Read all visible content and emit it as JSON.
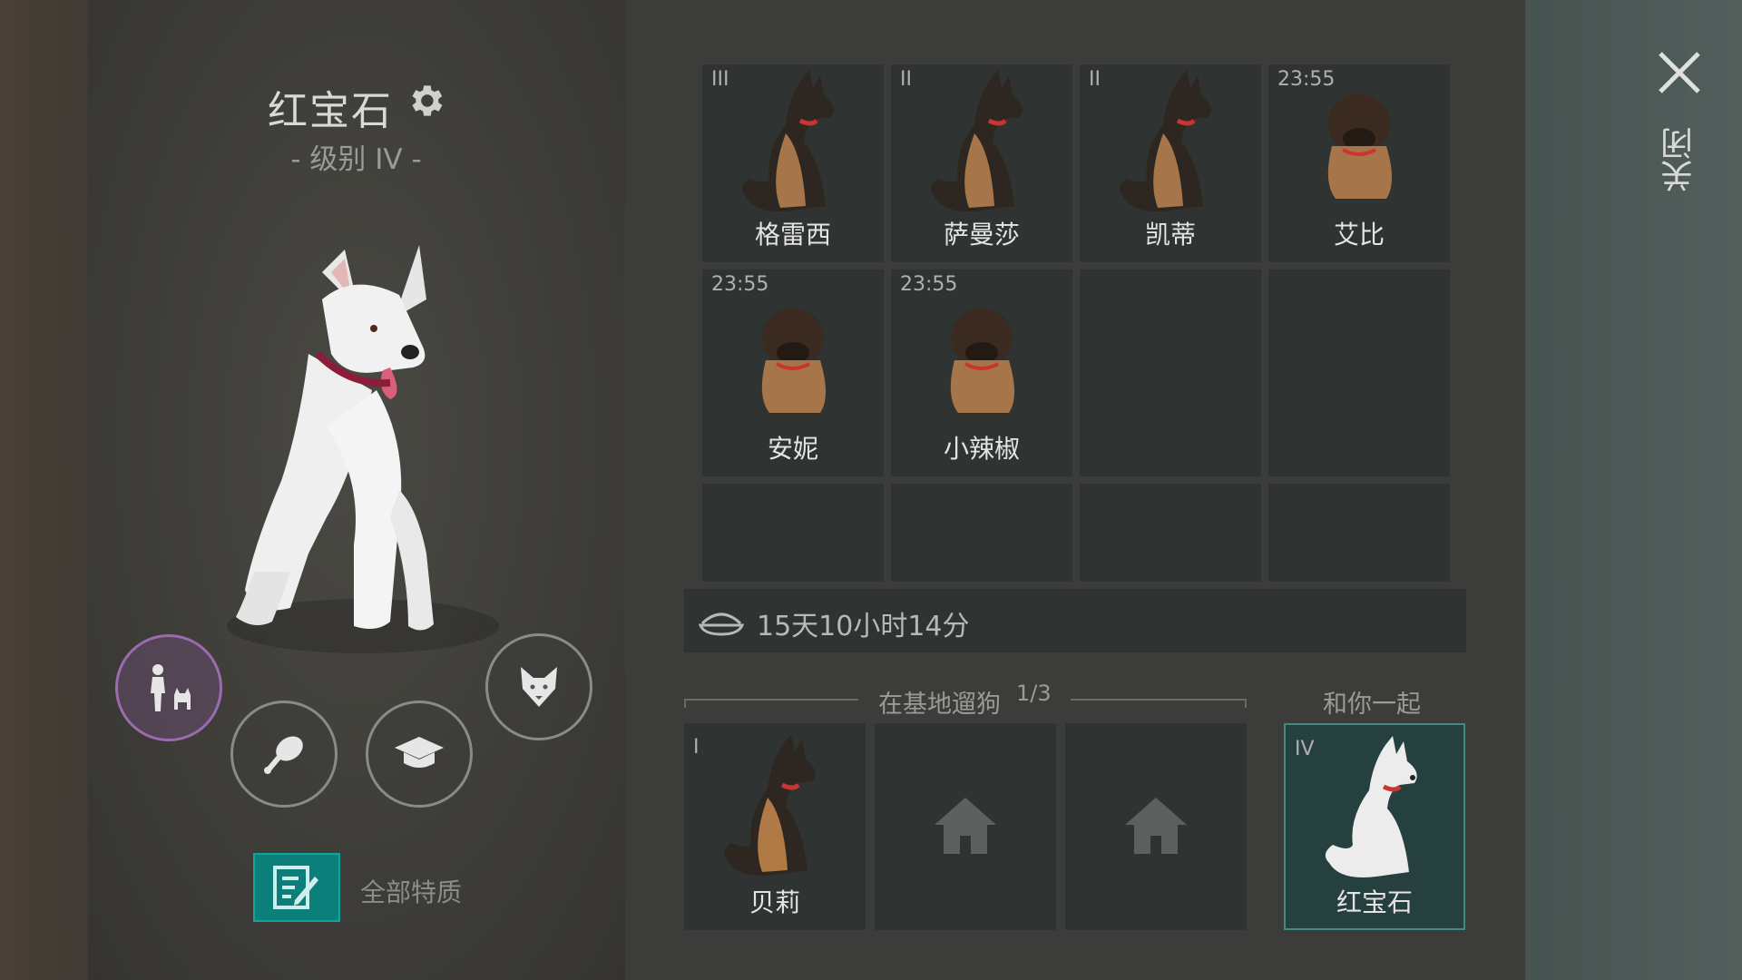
{
  "pet": {
    "name": "红宝石",
    "level": "- 级别 IV -"
  },
  "actions": {
    "traits_label": "全部特质"
  },
  "kennel": {
    "cells": [
      {
        "tag": "III",
        "name": "格雷西",
        "type": "adult-shepherd"
      },
      {
        "tag": "II",
        "name": "萨曼莎",
        "type": "adult-shepherd"
      },
      {
        "tag": "II",
        "name": "凯蒂",
        "type": "adult-shepherd"
      },
      {
        "tag": "23:55",
        "name": "艾比",
        "type": "puppy"
      },
      {
        "tag": "23:55",
        "name": "安妮",
        "type": "puppy"
      },
      {
        "tag": "23:55",
        "name": "小辣椒",
        "type": "puppy"
      }
    ]
  },
  "food": {
    "time_left": "15天10小时14分"
  },
  "walking": {
    "label": "在基地遛狗",
    "count": "1/3",
    "dogs": [
      {
        "tag": "I",
        "name": "贝莉"
      }
    ]
  },
  "with_you": {
    "label": "和你一起",
    "tag": "IV",
    "name": "红宝石"
  },
  "close_label": "关闭",
  "colors": {
    "accent_teal": "#12a39b",
    "active_ring": "#9b6bb0"
  }
}
